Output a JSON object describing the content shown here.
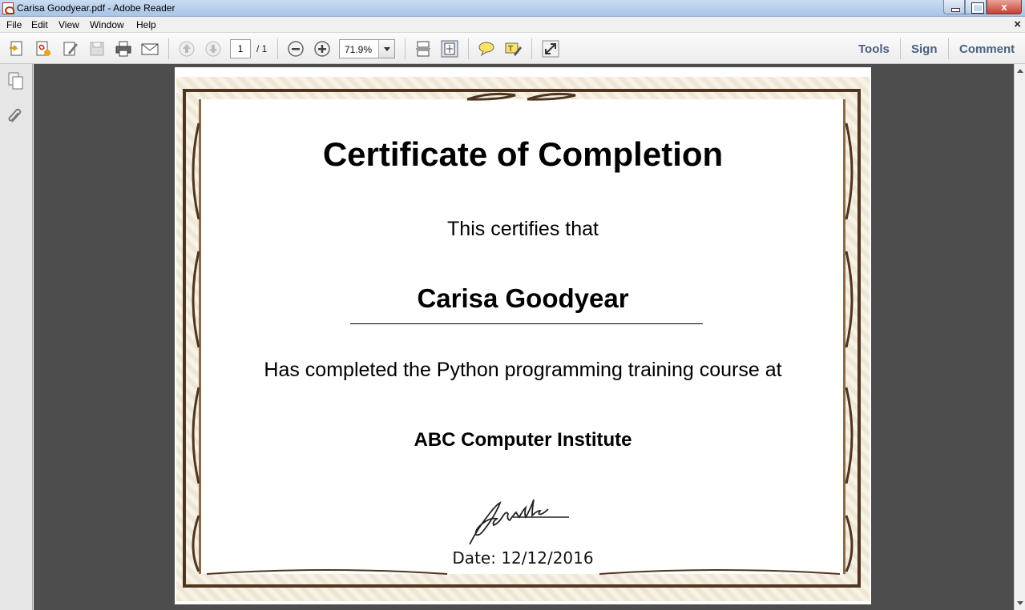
{
  "window": {
    "title": "Carisa Goodyear.pdf - Adobe Reader",
    "close_glyph": "x"
  },
  "menu": {
    "items": [
      "File",
      "Edit",
      "View",
      "Window",
      "Help"
    ],
    "doc_close": "×"
  },
  "toolbar": {
    "current_page": "1",
    "total_pages": "/ 1",
    "zoom": "71.9%",
    "tools_label": "Tools",
    "sign_label": "Sign",
    "comment_label": "Comment"
  },
  "certificate": {
    "title": "Certificate of Completion",
    "certifies": "This certifies that",
    "name": "Carisa Goodyear",
    "completed": "Has completed the Python programming training course at",
    "institute": "ABC Computer Institute",
    "date_label": "Date:",
    "date_value": "12/12/2016"
  },
  "colors": {
    "frame": "#4e3520",
    "doc_background": "#4d4d4d",
    "link": "#4a6180"
  }
}
